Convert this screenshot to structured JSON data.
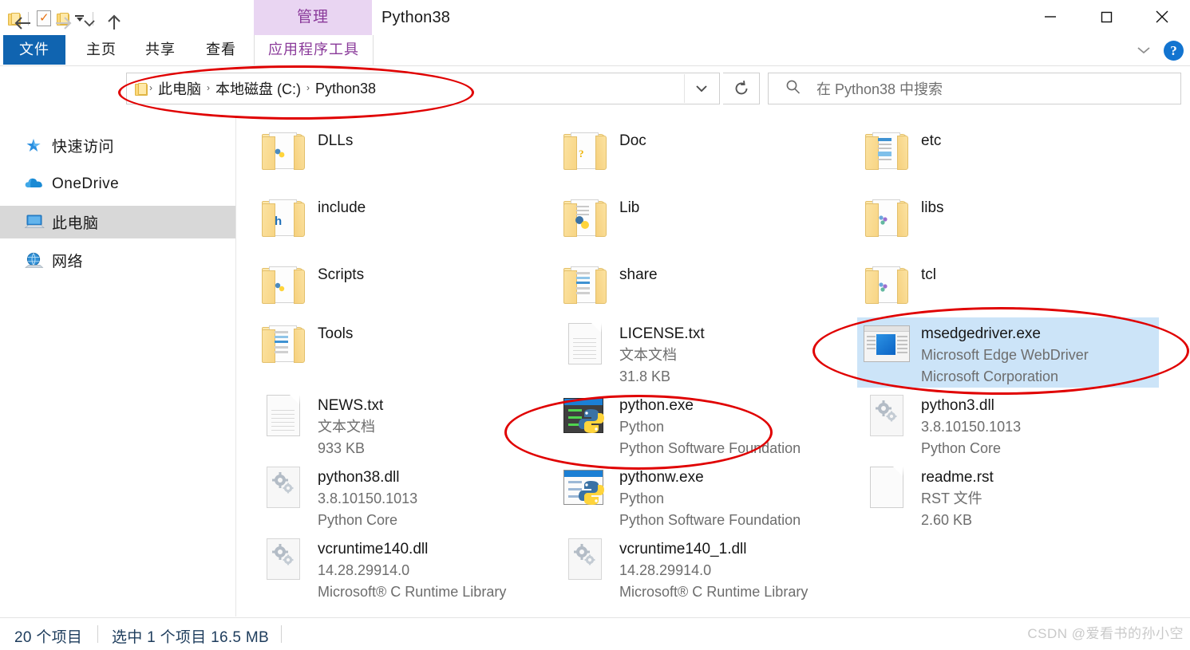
{
  "window": {
    "title": "Python38",
    "contextual_tab_group": "管理",
    "quick_access": [
      "folder-icon",
      "properties-checkmark-icon",
      "new-folder-icon",
      "customize-dropdown-icon"
    ],
    "controls": {
      "minimize": "minimize-icon",
      "maximize": "maximize-icon",
      "close": "close-icon"
    }
  },
  "ribbon": {
    "tabs": [
      {
        "label": "文件",
        "active": false
      },
      {
        "label": "主页",
        "active": false
      },
      {
        "label": "共享",
        "active": false
      },
      {
        "label": "查看",
        "active": false
      },
      {
        "label": "应用程序工具",
        "active": true
      }
    ],
    "collapse_label": "chevron-down-icon",
    "help_label": "?"
  },
  "address": {
    "back": "back-arrow-icon",
    "forward": "forward-arrow-icon",
    "recent": "recent-locations-icon",
    "up": "up-arrow-icon",
    "crumbs": [
      "此电脑",
      "本地磁盘 (C:)",
      "Python38"
    ],
    "separator": "›",
    "dropdown": "chevron-down-icon",
    "refresh": "refresh-icon"
  },
  "search": {
    "placeholder": "在 Python38 中搜索",
    "icon": "search-icon",
    "value": ""
  },
  "sidebar": {
    "items": [
      {
        "label": "快速访问",
        "icon": "star-pin-icon",
        "selected": false
      },
      {
        "label": "OneDrive",
        "icon": "cloud-icon",
        "selected": false
      },
      {
        "label": "此电脑",
        "icon": "computer-icon",
        "selected": true
      },
      {
        "label": "网络",
        "icon": "network-icon",
        "selected": false
      }
    ]
  },
  "files": [
    {
      "name": "DLLs",
      "type": "folder",
      "icon": "folder-python-icon",
      "sub1": "",
      "sub2": "",
      "selected": false,
      "col": 0,
      "row": 0
    },
    {
      "name": "Doc",
      "type": "folder",
      "icon": "folder-help-icon",
      "sub1": "",
      "sub2": "",
      "selected": false,
      "col": 1,
      "row": 0
    },
    {
      "name": "etc",
      "type": "folder",
      "icon": "folder-docs-icon",
      "sub1": "",
      "sub2": "",
      "selected": false,
      "col": 2,
      "row": 0
    },
    {
      "name": "include",
      "type": "folder",
      "icon": "folder-header-icon",
      "sub1": "",
      "sub2": "",
      "selected": false,
      "col": 0,
      "row": 1
    },
    {
      "name": "Lib",
      "type": "folder",
      "icon": "folder-python-icon",
      "sub1": "",
      "sub2": "",
      "selected": false,
      "col": 1,
      "row": 1
    },
    {
      "name": "libs",
      "type": "folder",
      "icon": "folder-generic-icon",
      "sub1": "",
      "sub2": "",
      "selected": false,
      "col": 2,
      "row": 1
    },
    {
      "name": "Scripts",
      "type": "folder",
      "icon": "folder-python-icon",
      "sub1": "",
      "sub2": "",
      "selected": false,
      "col": 0,
      "row": 2
    },
    {
      "name": "share",
      "type": "folder",
      "icon": "folder-docs-icon",
      "sub1": "",
      "sub2": "",
      "selected": false,
      "col": 1,
      "row": 2
    },
    {
      "name": "tcl",
      "type": "folder",
      "icon": "folder-generic-icon",
      "sub1": "",
      "sub2": "",
      "selected": false,
      "col": 2,
      "row": 2
    },
    {
      "name": "Tools",
      "type": "folder",
      "icon": "folder-docs-icon",
      "sub1": "",
      "sub2": "",
      "selected": false,
      "col": 0,
      "row": 3
    },
    {
      "name": "LICENSE.txt",
      "type": "file",
      "icon": "text-document-icon",
      "sub1": "文本文档",
      "sub2": "31.8 KB",
      "selected": false,
      "col": 1,
      "row": 3
    },
    {
      "name": "msedgedriver.exe",
      "type": "file",
      "icon": "edge-webdriver-icon",
      "sub1": "Microsoft Edge WebDriver",
      "sub2": "Microsoft Corporation",
      "selected": true,
      "col": 2,
      "row": 3
    },
    {
      "name": "NEWS.txt",
      "type": "file",
      "icon": "text-document-icon",
      "sub1": "文本文档",
      "sub2": "933 KB",
      "selected": false,
      "col": 0,
      "row": 4
    },
    {
      "name": "python.exe",
      "type": "file",
      "icon": "python-console-icon",
      "sub1": "Python",
      "sub2": "Python Software Foundation",
      "selected": false,
      "col": 1,
      "row": 4
    },
    {
      "name": "python3.dll",
      "type": "file",
      "icon": "dll-gear-icon",
      "sub1": "3.8.10150.1013",
      "sub2": "Python Core",
      "selected": false,
      "col": 2,
      "row": 4
    },
    {
      "name": "python38.dll",
      "type": "file",
      "icon": "dll-gear-icon",
      "sub1": "3.8.10150.1013",
      "sub2": "Python Core",
      "selected": false,
      "col": 0,
      "row": 5
    },
    {
      "name": "pythonw.exe",
      "type": "file",
      "icon": "pythonw-window-icon",
      "sub1": "Python",
      "sub2": "Python Software Foundation",
      "selected": false,
      "col": 1,
      "row": 5
    },
    {
      "name": "readme.rst",
      "type": "file",
      "icon": "plain-document-icon",
      "sub1": "RST 文件",
      "sub2": "2.60 KB",
      "selected": false,
      "col": 2,
      "row": 5
    },
    {
      "name": "vcruntime140.dll",
      "type": "file",
      "icon": "dll-gear-icon",
      "sub1": "14.28.29914.0",
      "sub2": "Microsoft® C Runtime Library",
      "selected": false,
      "col": 0,
      "row": 6
    },
    {
      "name": "vcruntime140_1.dll",
      "type": "file",
      "icon": "dll-gear-icon",
      "sub1": "14.28.29914.0",
      "sub2": "Microsoft® C Runtime Library",
      "selected": false,
      "col": 1,
      "row": 6
    }
  ],
  "status": {
    "item_count": "20 个项目",
    "selection": "选中 1 个项目  16.5 MB"
  },
  "watermark": "CSDN @爱看书的孙小空",
  "annotations": [
    {
      "name": "address-path-highlight",
      "target": "此电脑 › 本地磁盘 (C:) › Python38"
    },
    {
      "name": "python-exe-highlight",
      "target": "python.exe"
    },
    {
      "name": "msedgedriver-highlight",
      "target": "msedgedriver.exe"
    }
  ],
  "colors": {
    "file_tab_blue": "#1064b0",
    "contextual_purple": "#e9d5f2",
    "selection_blue": "#cce4f8",
    "sidebar_selected_gray": "#d8d8d8",
    "annotation_red": "#e00000",
    "status_text": "#1d3c5c"
  }
}
